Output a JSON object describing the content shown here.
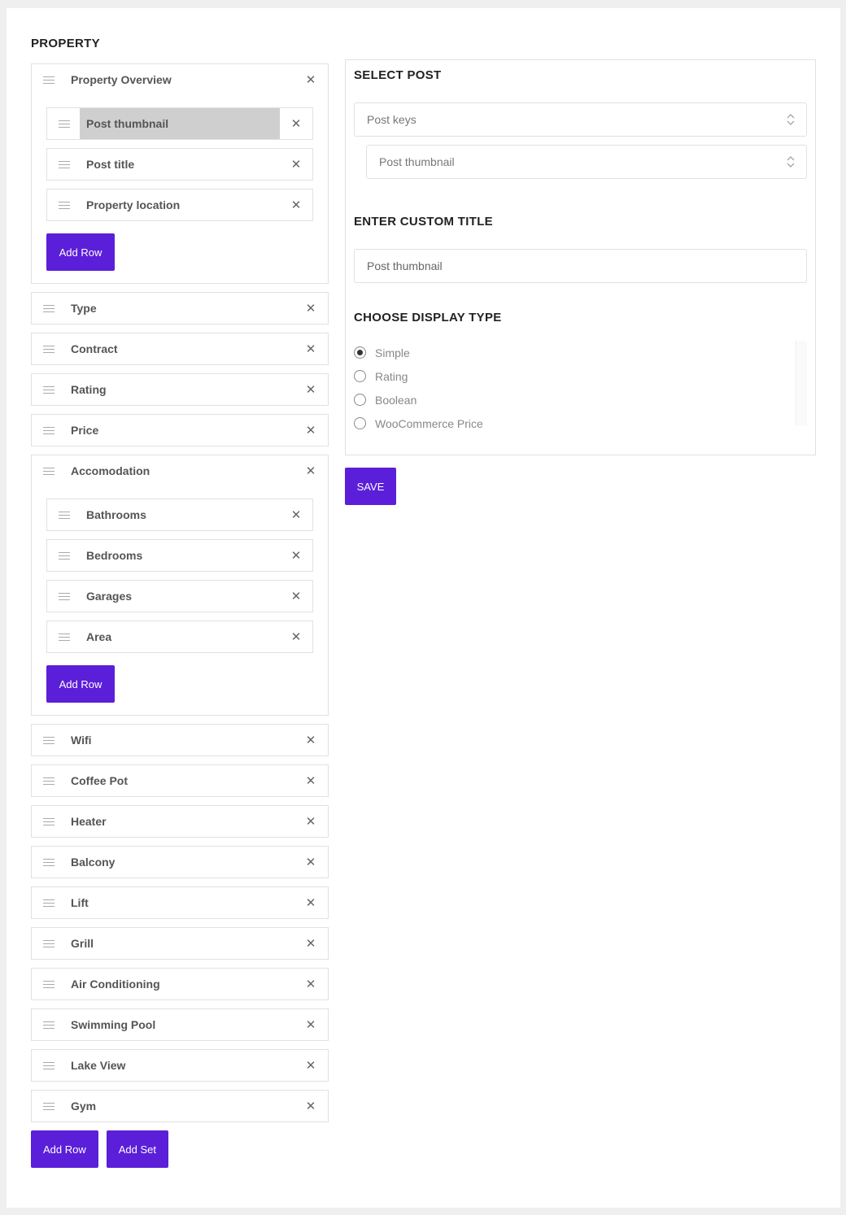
{
  "page": {
    "title": "PROPERTY"
  },
  "groups": [
    {
      "label": "Property Overview",
      "children": [
        {
          "label": "Post thumbnail",
          "active": true
        },
        {
          "label": "Post title"
        },
        {
          "label": "Property location"
        }
      ],
      "add_row_label": "Add Row"
    },
    {
      "label": "Type"
    },
    {
      "label": "Contract"
    },
    {
      "label": "Rating"
    },
    {
      "label": "Price"
    },
    {
      "label": "Accomodation",
      "children": [
        {
          "label": "Bathrooms"
        },
        {
          "label": "Bedrooms"
        },
        {
          "label": "Garages"
        },
        {
          "label": "Area"
        }
      ],
      "add_row_label": "Add Row"
    },
    {
      "label": "Wifi"
    },
    {
      "label": "Coffee Pot"
    },
    {
      "label": "Heater"
    },
    {
      "label": "Balcony"
    },
    {
      "label": "Lift"
    },
    {
      "label": "Grill"
    },
    {
      "label": "Air Conditioning"
    },
    {
      "label": "Swimming Pool"
    },
    {
      "label": "Lake View"
    },
    {
      "label": "Gym"
    }
  ],
  "close_glyph": "✕",
  "bottom": {
    "add_row_label": "Add Row",
    "add_set_label": "Add Set"
  },
  "editor": {
    "select_post_title": "SELECT POST",
    "post_keys_value": "Post keys",
    "post_field_value": "Post thumbnail",
    "custom_title_heading": "ENTER CUSTOM TITLE",
    "custom_title_value": "Post thumbnail",
    "display_type_heading": "CHOOSE DISPLAY TYPE",
    "display_types": [
      {
        "label": "Simple",
        "selected": true
      },
      {
        "label": "Rating",
        "selected": false
      },
      {
        "label": "Boolean",
        "selected": false
      },
      {
        "label": "WooCommerce Price",
        "selected": false
      }
    ],
    "save_label": "SAVE"
  },
  "colors": {
    "accent": "#5b1fd9",
    "active_row": "#cfcfcf",
    "border": "#e1e1e1"
  },
  "icons": {
    "drag": "drag-handle-icon",
    "close": "close-icon",
    "select": "chevron-updown-icon"
  }
}
